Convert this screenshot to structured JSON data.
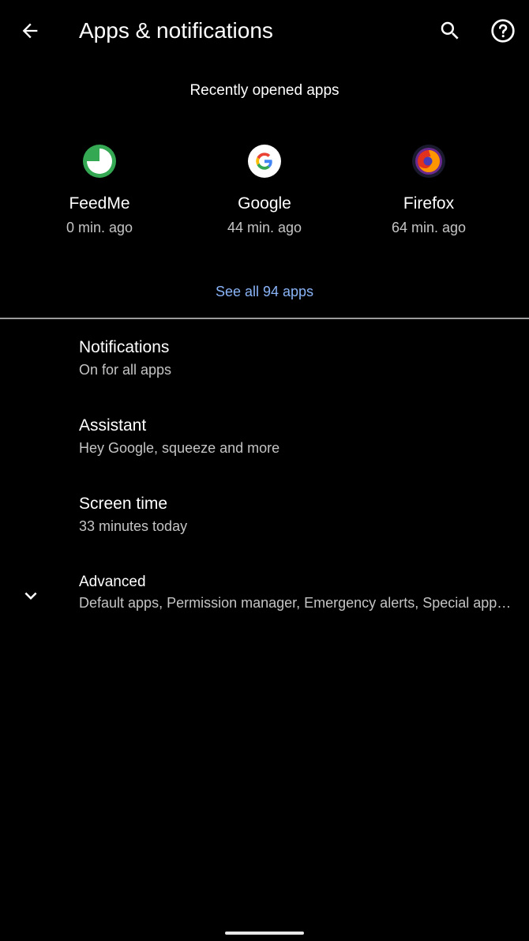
{
  "toolbar": {
    "title": "Apps & notifications",
    "back_icon": "arrow-back-icon",
    "search_icon": "search-icon",
    "help_icon": "help-icon"
  },
  "recent": {
    "header": "Recently opened apps",
    "apps": [
      {
        "name": "FeedMe",
        "time": "0 min. ago",
        "icon": "feedme-icon"
      },
      {
        "name": "Google",
        "time": "44 min. ago",
        "icon": "google-icon"
      },
      {
        "name": "Firefox",
        "time": "64 min. ago",
        "icon": "firefox-icon"
      }
    ],
    "see_all": "See all 94 apps"
  },
  "settings": [
    {
      "title": "Notifications",
      "subtitle": "On for all apps"
    },
    {
      "title": "Assistant",
      "subtitle": "Hey Google, squeeze and more"
    },
    {
      "title": "Screen time",
      "subtitle": "33 minutes today"
    },
    {
      "title": "Advanced",
      "subtitle": "Default apps, Permission manager, Emergency alerts, Special app access"
    }
  ],
  "colors": {
    "background": "#000000",
    "text_primary": "#ffffff",
    "text_secondary": "#c4c4c4",
    "accent_link": "#8ab4f8",
    "feedme_green": "#34a853"
  }
}
